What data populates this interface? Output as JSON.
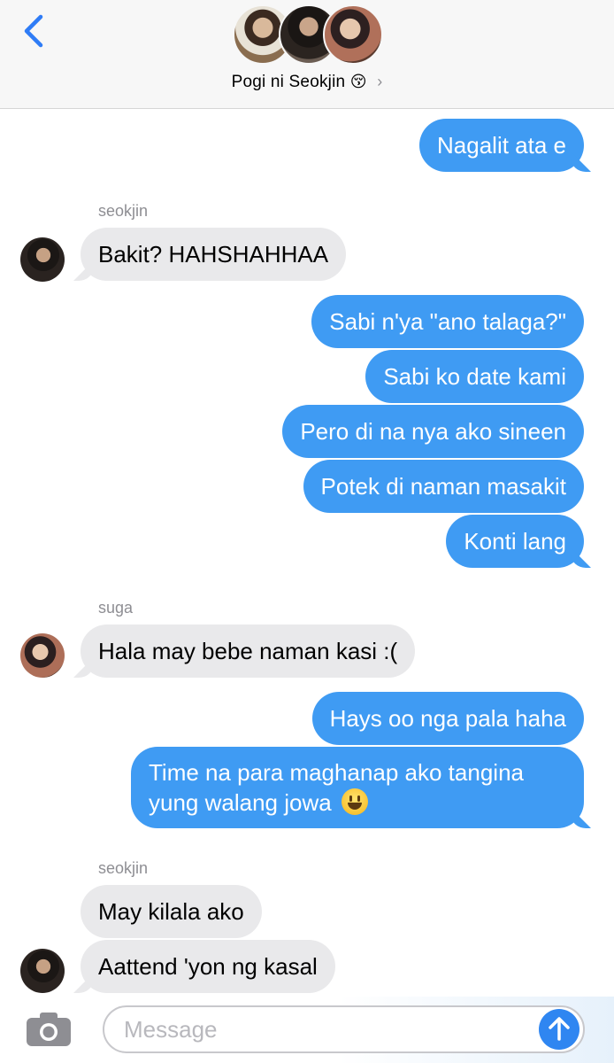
{
  "header": {
    "group_name": "Pogi ni Seokjin",
    "group_emoji": "😚",
    "chevron": "›",
    "avatars": [
      "avatar-member-1",
      "avatar-member-2",
      "avatar-member-3"
    ],
    "back_icon": "chevron-left-icon"
  },
  "messages": [
    {
      "direction": "out",
      "text": "Nagalit ata e"
    },
    {
      "sender": "seokjin",
      "direction": "in",
      "text": "Bakit? HAHSHAHHAA"
    },
    {
      "direction": "out",
      "text": "Sabi n'ya \"ano talaga?\""
    },
    {
      "direction": "out",
      "text": "Sabi ko date kami"
    },
    {
      "direction": "out",
      "text": "Pero di na nya ako sineen"
    },
    {
      "direction": "out",
      "text": "Potek di naman masakit"
    },
    {
      "direction": "out",
      "text": "Konti lang"
    },
    {
      "sender": "suga",
      "direction": "in",
      "text": "Hala may bebe naman kasi :("
    },
    {
      "direction": "out",
      "text": "Hays oo nga pala haha"
    },
    {
      "direction": "out",
      "line1": "Time na para maghanap ako tangina",
      "line2": "yung walang jowa",
      "emoji": "smiley-emoji"
    },
    {
      "sender": "seokjin",
      "direction": "in",
      "text": "May kilala ako"
    },
    {
      "direction": "in",
      "text": "Aattend 'yon ng kasal"
    }
  ],
  "senders": {
    "first": "seokjin",
    "second": "suga",
    "third": "seokjin"
  },
  "composer": {
    "placeholder": "Message",
    "value": "",
    "camera_icon": "camera-icon",
    "send_icon": "arrow-up-icon"
  },
  "colors": {
    "outgoing": "#3f9bf3",
    "incoming": "#e9e9eb",
    "accent": "#2f86f1",
    "header_bg": "#f7f7f7"
  }
}
